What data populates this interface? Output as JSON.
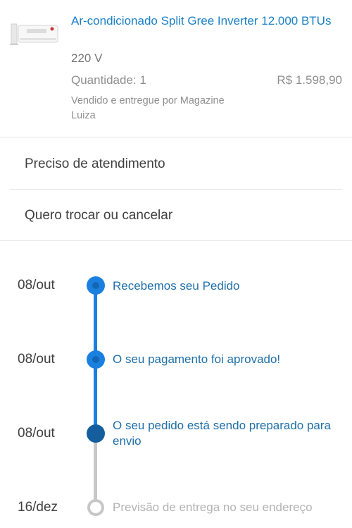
{
  "product": {
    "image_icon": "air-conditioner-image",
    "title": "Ar-condicionado Split Gree Inverter 12.000 BTUs",
    "voltage": "220 V",
    "quantity": "Quantidade: 1",
    "price": "R$ 1.598,90",
    "seller": "Vendido e entregue por Magazine Luiza"
  },
  "menu": {
    "support": "Preciso de atendimento",
    "exchange_cancel": "Quero trocar ou cancelar"
  },
  "timeline": {
    "steps": [
      {
        "date": "08/out",
        "text": "Recebemos seu Pedido",
        "status": "done"
      },
      {
        "date": "08/out",
        "text": "O seu pagamento foi aprovado!",
        "status": "done"
      },
      {
        "date": "08/out",
        "text": "O seu pedido está sendo preparado para envio",
        "status": "current"
      },
      {
        "date": "16/dez",
        "text": "Previsão de entrega no seu endereço",
        "status": "pending"
      }
    ]
  },
  "colors": {
    "accent": "#1a80e0",
    "title_blue": "#1a80c6",
    "step_text": "#1f6fa8",
    "pending_gray": "#c7c7c7"
  }
}
